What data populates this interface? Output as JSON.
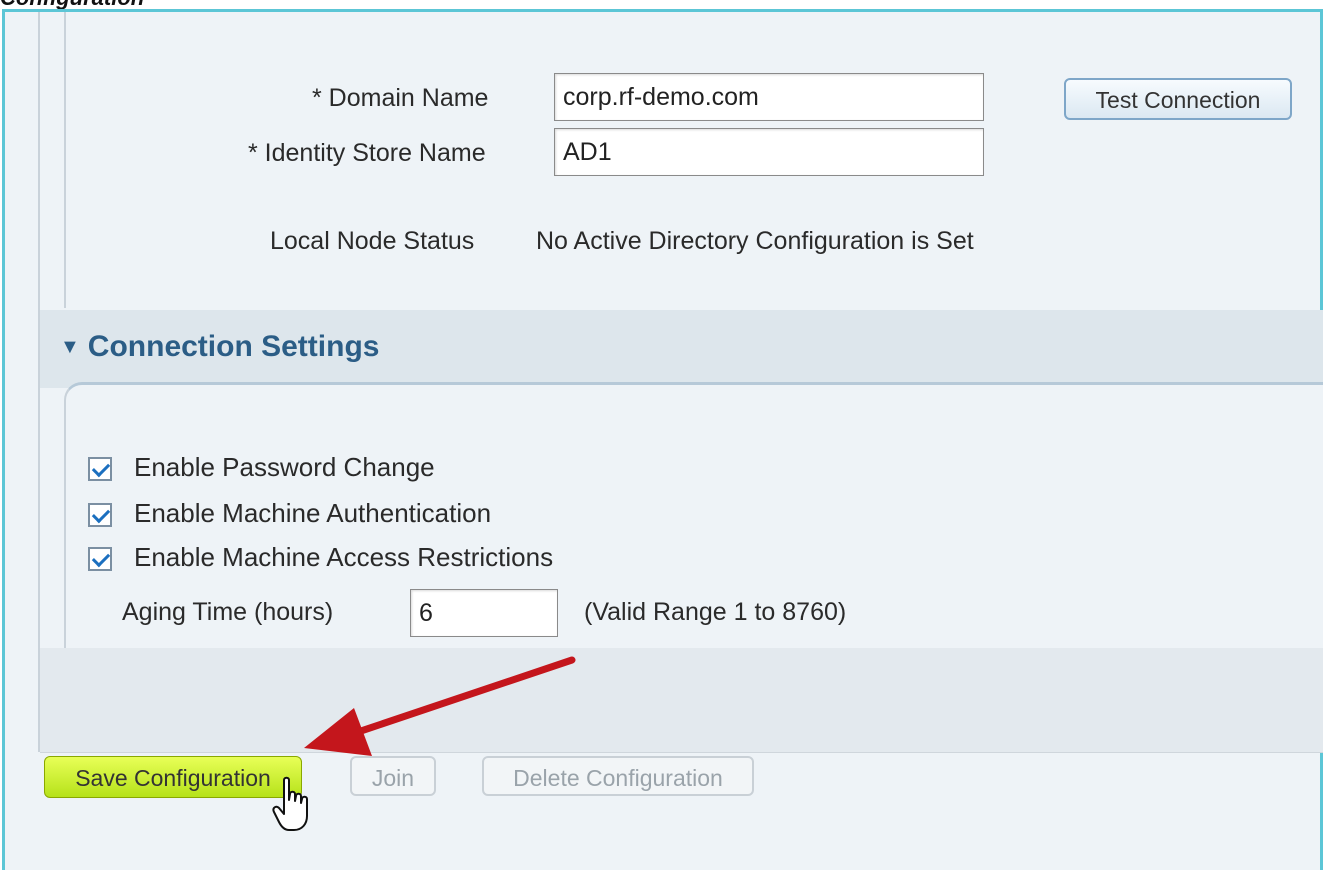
{
  "page": {
    "caption": "Configuration"
  },
  "form": {
    "domain_name_label": "* Domain Name",
    "domain_name_value": "corp.rf-demo.com",
    "identity_store_label": "* Identity Store Name",
    "identity_store_value": "AD1",
    "test_connection_label": "Test Connection",
    "local_node_status_label": "Local Node Status",
    "local_node_status_value": "No Active Directory Configuration is Set"
  },
  "connection_settings": {
    "title": "Connection Settings",
    "expanded": true,
    "checkboxes": [
      {
        "label": "Enable Password Change",
        "checked": true
      },
      {
        "label": "Enable Machine Authentication",
        "checked": true
      },
      {
        "label": "Enable Machine Access Restrictions",
        "checked": true
      }
    ],
    "aging_time_label": "Aging Time (hours)",
    "aging_time_value": "6",
    "aging_range_hint": "(Valid Range 1 to 8760)"
  },
  "actions": {
    "save_label": "Save Configuration",
    "join_label": "Join",
    "delete_label": "Delete Configuration"
  },
  "colors": {
    "frame_border": "#5cc6d6",
    "section_title": "#2b5d86",
    "save_button": "#c8ee2a",
    "annotation_arrow": "#c4161c"
  },
  "icons": {
    "collapse": "triangle-down-icon",
    "checkbox": "checkmark-icon",
    "cursor": "hand-pointer-icon",
    "annotation": "red-arrow-icon"
  }
}
